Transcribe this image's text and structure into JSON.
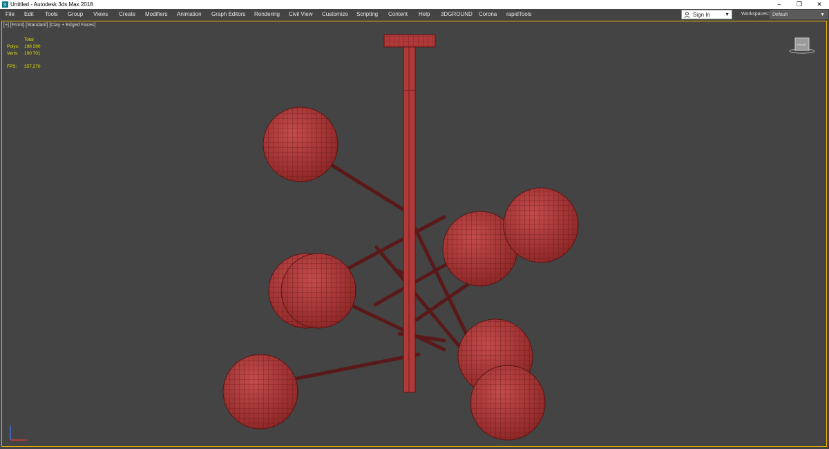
{
  "window": {
    "title": "Untitled - Autodesk 3ds Max 2018",
    "controls": [
      "–",
      "❐",
      "✕"
    ]
  },
  "menu": [
    "File",
    "Edit",
    "Tools",
    "Group",
    "Views",
    "Create",
    "Modifiers",
    "Animation",
    "Graph Editors",
    "Rendering",
    "Civil View",
    "Customize",
    "Scripting",
    "Content",
    "Help",
    "3DGROUND",
    "Corona",
    "rapidTools"
  ],
  "account": {
    "signin": "Sign In"
  },
  "workspaces": {
    "label": "Workspaces:",
    "value": "Default"
  },
  "viewport": {
    "label": "[+] [Front] [Standard] [Clay + Edged Faces]",
    "stats": {
      "total_label": "Total",
      "polys_label": "Polys:",
      "polys_value": "198 280",
      "verts_label": "Verts:",
      "verts_value": "100 701",
      "fps_label": "FPS:",
      "fps_value": "357,270"
    },
    "viewcube_label": "FRONT"
  },
  "colors": {
    "background": "#444444",
    "model_fill": "#b03a3a",
    "model_wire": "#5a1414",
    "rod": "#5a1818",
    "viewport_border": "#eeb800",
    "stats_text": "#e3e300"
  }
}
